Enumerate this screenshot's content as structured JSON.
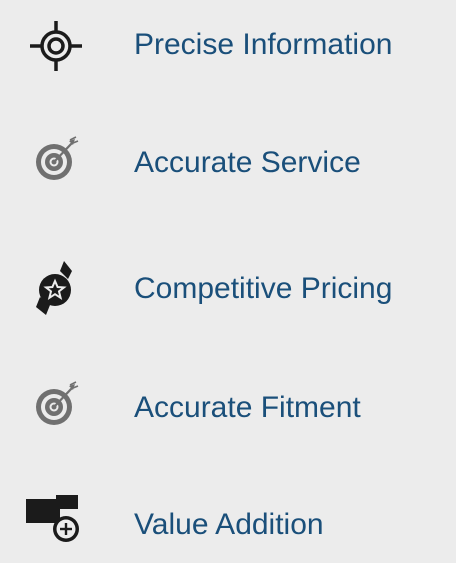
{
  "colors": {
    "background": "#ececec",
    "label_text": "#1a4f7a",
    "icon_dark": "#1b1b1b",
    "icon_grey": "#707070"
  },
  "features": [
    {
      "label": "Precise Information",
      "icon": "crosshair-icon"
    },
    {
      "label": "Accurate Service",
      "icon": "target-arrow-icon"
    },
    {
      "label": "Competitive Pricing",
      "icon": "star-badge-icon"
    },
    {
      "label": "Accurate Fitment",
      "icon": "target-arrow-icon"
    },
    {
      "label": "Value Addition",
      "icon": "plus-box-icon"
    }
  ]
}
